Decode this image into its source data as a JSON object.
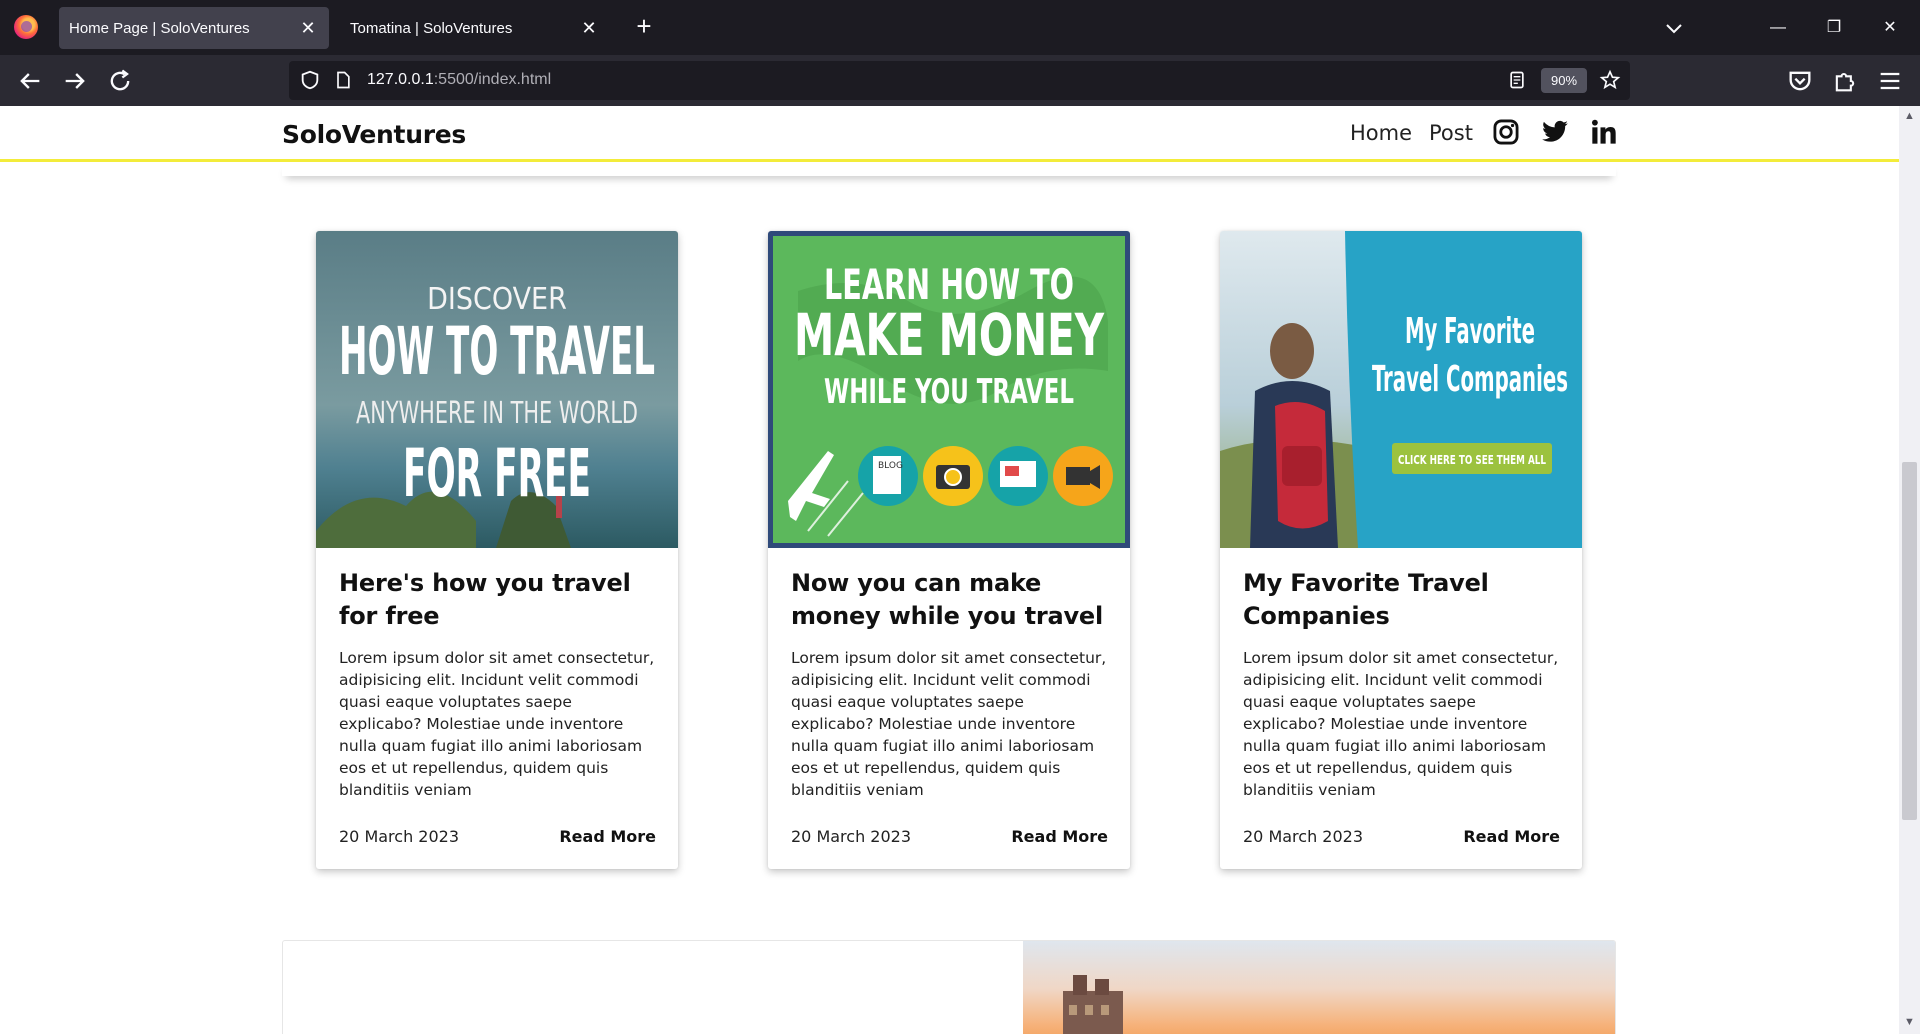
{
  "browser": {
    "tabs": [
      {
        "label": "Home Page | SoloVentures",
        "active": true
      },
      {
        "label": "Tomatina | SoloVentures",
        "active": false
      }
    ],
    "url_host": "127.0.0.1",
    "url_rest": ":5500/index.html",
    "zoom": "90%"
  },
  "site": {
    "brand": "SoloVentures",
    "nav": [
      "Home",
      "Post"
    ],
    "social_icons": [
      "instagram-icon",
      "twitter-icon",
      "linkedin-icon"
    ],
    "accent_color": "#f3ec3a"
  },
  "cards": [
    {
      "image_text": {
        "line1": "DISCOVER",
        "line2": "HOW TO TRAVEL",
        "line3": "ANYWHERE IN THE WORLD",
        "line4": "FOR FREE"
      },
      "title": "Here's how you travel for free",
      "body": "Lorem ipsum dolor sit amet consectetur, adipisicing elit. Incidunt velit commodi quasi eaque voluptates saepe explicabo? Molestiae unde inventore nulla quam fugiat illo animi laboriosam eos et ut repellendus, quidem quis blanditiis veniam",
      "date": "20 March 2023",
      "read_more": "Read More"
    },
    {
      "image_text": {
        "line1": "LEARN HOW TO",
        "line2": "MAKE MONEY",
        "line3": "WHILE YOU TRAVEL",
        "badge": "BLOG"
      },
      "title": "Now you can make money while you travel",
      "body": "Lorem ipsum dolor sit amet consectetur, adipisicing elit. Incidunt velit commodi quasi eaque voluptates saepe explicabo? Molestiae unde inventore nulla quam fugiat illo animi laboriosam eos et ut repellendus, quidem quis blanditiis veniam",
      "date": "20 March 2023",
      "read_more": "Read More"
    },
    {
      "image_text": {
        "line1": "My Favorite",
        "line2": "Travel Companies",
        "button": "CLICK HERE TO SEE THEM ALL"
      },
      "title": "My Favorite Travel Companies",
      "body": "Lorem ipsum dolor sit amet consectetur, adipisicing elit. Incidunt velit commodi quasi eaque voluptates saepe explicabo? Molestiae unde inventore nulla quam fugiat illo animi laboriosam eos et ut repellendus, quidem quis blanditiis veniam",
      "date": "20 March 2023",
      "read_more": "Read More"
    }
  ]
}
